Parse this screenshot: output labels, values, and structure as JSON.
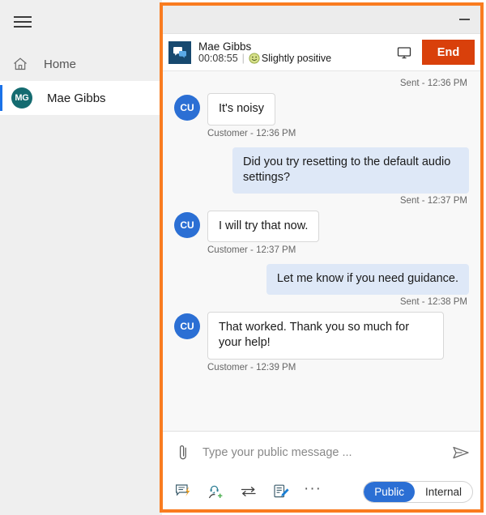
{
  "sidebar": {
    "menu_icon": "hamburger-icon",
    "items": [
      {
        "label": "Home",
        "icon": "home-icon",
        "active": false
      },
      {
        "label": "Mae Gibbs",
        "icon": "avatar",
        "initials": "MG",
        "active": true
      }
    ]
  },
  "window": {
    "minimize_label": "Minimize",
    "accent_border": "#f97c20"
  },
  "conversation": {
    "icon": "chat-bubbles-icon",
    "name": "Mae Gibbs",
    "timer": "00:08:55",
    "divider": "|",
    "sentiment_icon": "smiley-face-icon",
    "sentiment": "Slightly positive",
    "monitor_icon": "monitor-icon",
    "end_label": "End",
    "end_color": "#d9400b"
  },
  "messages": [
    {
      "type": "stamp_sent",
      "text": "Sent - 12:36 PM"
    },
    {
      "type": "incoming",
      "initials": "CU",
      "text": "It's noisy",
      "stamp": "Customer - 12:36 PM"
    },
    {
      "type": "outgoing",
      "text": "Did you try resetting to the default audio settings?",
      "stamp": "Sent - 12:37 PM"
    },
    {
      "type": "incoming",
      "initials": "CU",
      "text": "I will try that now.",
      "stamp": "Customer - 12:37 PM"
    },
    {
      "type": "outgoing",
      "text": "Let me know if you need guidance.",
      "stamp": "Sent - 12:38 PM"
    },
    {
      "type": "incoming",
      "initials": "CU",
      "text": "That worked. Thank you so much for your help!",
      "stamp": "Customer - 12:39 PM"
    }
  ],
  "composer": {
    "attach_icon": "paperclip-icon",
    "placeholder": "Type your public message ...",
    "value": "",
    "send_icon": "send-icon",
    "tools": [
      {
        "name": "quick-replies-icon",
        "label": "Quick replies"
      },
      {
        "name": "add-agent-icon",
        "label": "Add agent"
      },
      {
        "name": "transfer-icon",
        "label": "Transfer"
      },
      {
        "name": "notes-icon",
        "label": "Notes"
      }
    ],
    "more_label": "···",
    "toggle": {
      "options": [
        {
          "label": "Public",
          "selected": true
        },
        {
          "label": "Internal",
          "selected": false
        }
      ],
      "selected_color": "#2b6fd4"
    }
  }
}
